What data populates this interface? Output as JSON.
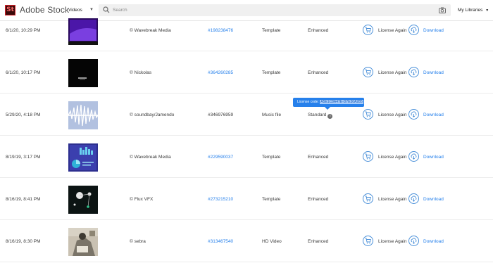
{
  "app": {
    "logo_text": "St",
    "title": "Adobe Stock"
  },
  "header": {
    "scope_select": "Videos",
    "search_placeholder": "Search",
    "my_libraries": "My Libraries",
    "icons": [
      "search-icon",
      "camera-icon",
      "chevron-down-icon"
    ]
  },
  "actions": {
    "license_again": "License Again",
    "download": "Download"
  },
  "tooltip": {
    "label": "License code:",
    "code": "A5E1C8A47E-D7E30A285"
  },
  "rows": [
    {
      "date": "6/1/20, 10:29 PM",
      "artist": "© Wavebreak Media",
      "asset_id": "#198238476",
      "type": "Template",
      "license": "Enhanced",
      "thumb": "purple-template"
    },
    {
      "date": "6/1/20, 10:17 PM",
      "artist": "© Nickolas",
      "asset_id": "#364260285",
      "type": "Template",
      "license": "Enhanced",
      "thumb": "black-template"
    },
    {
      "date": "5/29/20, 4:18 PM",
      "artist": "© soundbay/Jamendo",
      "asset_id": "#346976959",
      "type": "Music file",
      "license": "Standard",
      "thumb": "waveform"
    },
    {
      "date": "8/19/19, 3:17 PM",
      "artist": "© Wavebreak Media",
      "asset_id": "#229590037",
      "type": "Template",
      "license": "Enhanced",
      "thumb": "chart-template"
    },
    {
      "date": "8/16/19, 8:41 PM",
      "artist": "© Flux VFX",
      "asset_id": "#273215210",
      "type": "Template",
      "license": "Enhanced",
      "thumb": "flux-template"
    },
    {
      "date": "8/16/19, 8:30 PM",
      "artist": "© sebra",
      "asset_id": "#313467540",
      "type": "HD Video",
      "license": "Enhanced",
      "thumb": "photo-video"
    }
  ]
}
